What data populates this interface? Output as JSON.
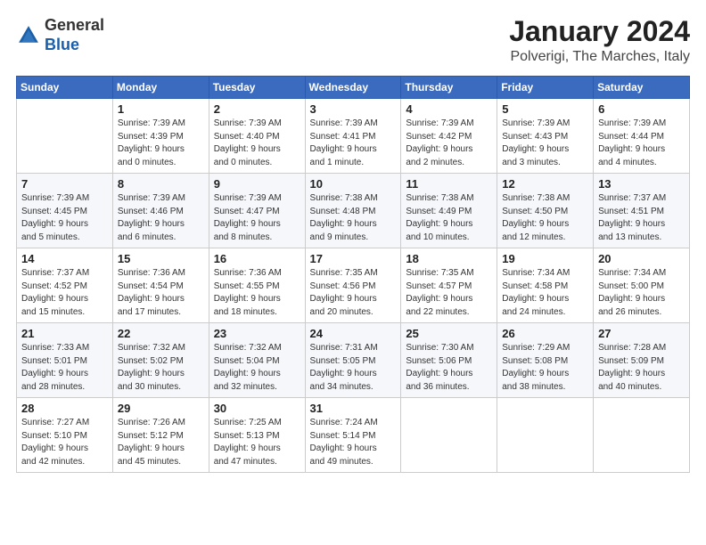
{
  "logo": {
    "general": "General",
    "blue": "Blue"
  },
  "header": {
    "month": "January 2024",
    "location": "Polverigi, The Marches, Italy"
  },
  "columns": [
    "Sunday",
    "Monday",
    "Tuesday",
    "Wednesday",
    "Thursday",
    "Friday",
    "Saturday"
  ],
  "weeks": [
    [
      {
        "day": "",
        "info": ""
      },
      {
        "day": "1",
        "info": "Sunrise: 7:39 AM\nSunset: 4:39 PM\nDaylight: 9 hours\nand 0 minutes."
      },
      {
        "day": "2",
        "info": "Sunrise: 7:39 AM\nSunset: 4:40 PM\nDaylight: 9 hours\nand 0 minutes."
      },
      {
        "day": "3",
        "info": "Sunrise: 7:39 AM\nSunset: 4:41 PM\nDaylight: 9 hours\nand 1 minute."
      },
      {
        "day": "4",
        "info": "Sunrise: 7:39 AM\nSunset: 4:42 PM\nDaylight: 9 hours\nand 2 minutes."
      },
      {
        "day": "5",
        "info": "Sunrise: 7:39 AM\nSunset: 4:43 PM\nDaylight: 9 hours\nand 3 minutes."
      },
      {
        "day": "6",
        "info": "Sunrise: 7:39 AM\nSunset: 4:44 PM\nDaylight: 9 hours\nand 4 minutes."
      }
    ],
    [
      {
        "day": "7",
        "info": "Sunrise: 7:39 AM\nSunset: 4:45 PM\nDaylight: 9 hours\nand 5 minutes."
      },
      {
        "day": "8",
        "info": "Sunrise: 7:39 AM\nSunset: 4:46 PM\nDaylight: 9 hours\nand 6 minutes."
      },
      {
        "day": "9",
        "info": "Sunrise: 7:39 AM\nSunset: 4:47 PM\nDaylight: 9 hours\nand 8 minutes."
      },
      {
        "day": "10",
        "info": "Sunrise: 7:38 AM\nSunset: 4:48 PM\nDaylight: 9 hours\nand 9 minutes."
      },
      {
        "day": "11",
        "info": "Sunrise: 7:38 AM\nSunset: 4:49 PM\nDaylight: 9 hours\nand 10 minutes."
      },
      {
        "day": "12",
        "info": "Sunrise: 7:38 AM\nSunset: 4:50 PM\nDaylight: 9 hours\nand 12 minutes."
      },
      {
        "day": "13",
        "info": "Sunrise: 7:37 AM\nSunset: 4:51 PM\nDaylight: 9 hours\nand 13 minutes."
      }
    ],
    [
      {
        "day": "14",
        "info": "Sunrise: 7:37 AM\nSunset: 4:52 PM\nDaylight: 9 hours\nand 15 minutes."
      },
      {
        "day": "15",
        "info": "Sunrise: 7:36 AM\nSunset: 4:54 PM\nDaylight: 9 hours\nand 17 minutes."
      },
      {
        "day": "16",
        "info": "Sunrise: 7:36 AM\nSunset: 4:55 PM\nDaylight: 9 hours\nand 18 minutes."
      },
      {
        "day": "17",
        "info": "Sunrise: 7:35 AM\nSunset: 4:56 PM\nDaylight: 9 hours\nand 20 minutes."
      },
      {
        "day": "18",
        "info": "Sunrise: 7:35 AM\nSunset: 4:57 PM\nDaylight: 9 hours\nand 22 minutes."
      },
      {
        "day": "19",
        "info": "Sunrise: 7:34 AM\nSunset: 4:58 PM\nDaylight: 9 hours\nand 24 minutes."
      },
      {
        "day": "20",
        "info": "Sunrise: 7:34 AM\nSunset: 5:00 PM\nDaylight: 9 hours\nand 26 minutes."
      }
    ],
    [
      {
        "day": "21",
        "info": "Sunrise: 7:33 AM\nSunset: 5:01 PM\nDaylight: 9 hours\nand 28 minutes."
      },
      {
        "day": "22",
        "info": "Sunrise: 7:32 AM\nSunset: 5:02 PM\nDaylight: 9 hours\nand 30 minutes."
      },
      {
        "day": "23",
        "info": "Sunrise: 7:32 AM\nSunset: 5:04 PM\nDaylight: 9 hours\nand 32 minutes."
      },
      {
        "day": "24",
        "info": "Sunrise: 7:31 AM\nSunset: 5:05 PM\nDaylight: 9 hours\nand 34 minutes."
      },
      {
        "day": "25",
        "info": "Sunrise: 7:30 AM\nSunset: 5:06 PM\nDaylight: 9 hours\nand 36 minutes."
      },
      {
        "day": "26",
        "info": "Sunrise: 7:29 AM\nSunset: 5:08 PM\nDaylight: 9 hours\nand 38 minutes."
      },
      {
        "day": "27",
        "info": "Sunrise: 7:28 AM\nSunset: 5:09 PM\nDaylight: 9 hours\nand 40 minutes."
      }
    ],
    [
      {
        "day": "28",
        "info": "Sunrise: 7:27 AM\nSunset: 5:10 PM\nDaylight: 9 hours\nand 42 minutes."
      },
      {
        "day": "29",
        "info": "Sunrise: 7:26 AM\nSunset: 5:12 PM\nDaylight: 9 hours\nand 45 minutes."
      },
      {
        "day": "30",
        "info": "Sunrise: 7:25 AM\nSunset: 5:13 PM\nDaylight: 9 hours\nand 47 minutes."
      },
      {
        "day": "31",
        "info": "Sunrise: 7:24 AM\nSunset: 5:14 PM\nDaylight: 9 hours\nand 49 minutes."
      },
      {
        "day": "",
        "info": ""
      },
      {
        "day": "",
        "info": ""
      },
      {
        "day": "",
        "info": ""
      }
    ]
  ]
}
